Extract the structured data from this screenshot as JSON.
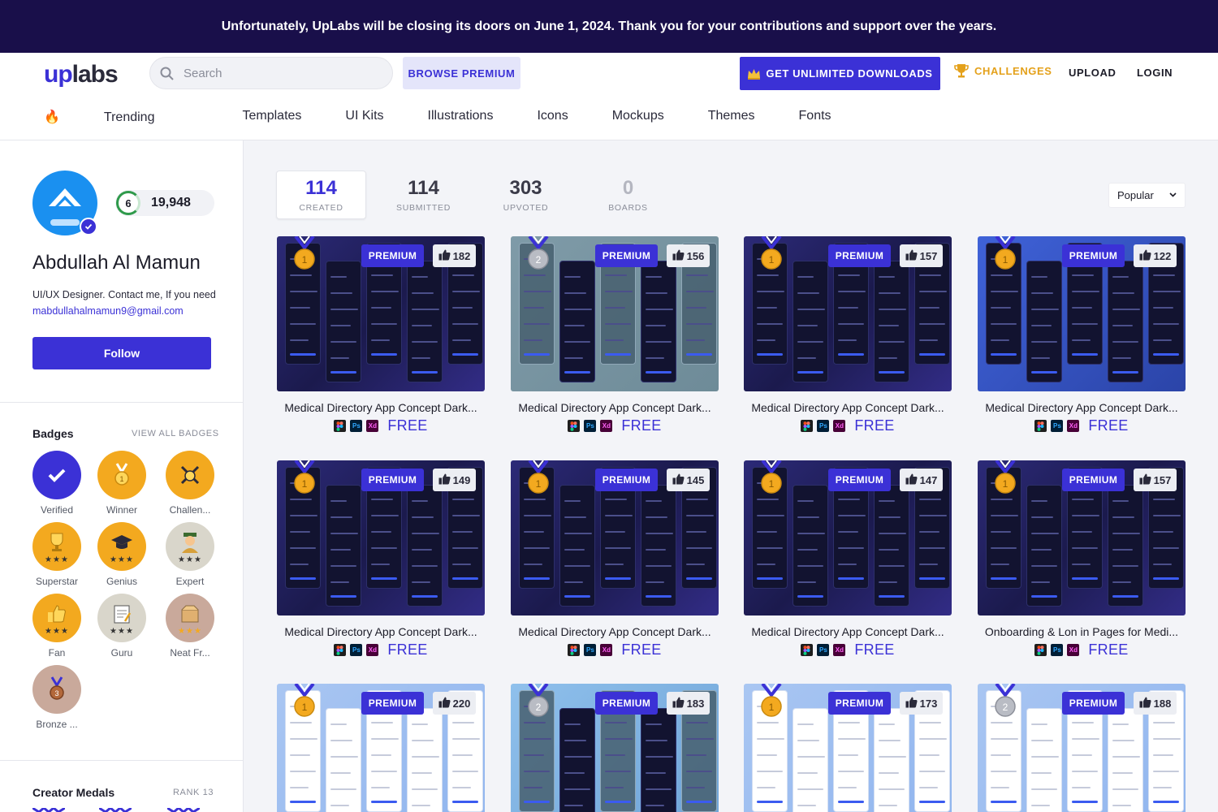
{
  "banner": {
    "text": "Unfortunately, UpLabs will be closing its doors on June 1, 2024. Thank you for your contributions and support over the years."
  },
  "header": {
    "logo_up": "up",
    "logo_labs": "labs",
    "search_placeholder": "Search",
    "browse_premium": "BROWSE PREMIUM",
    "get_unlimited": "GET UNLIMITED DOWNLOADS",
    "challenges": "CHALLENGES",
    "upload": "UPLOAD",
    "login": "LOGIN"
  },
  "nav": [
    {
      "label": "Trending",
      "icon": "fire-icon"
    },
    {
      "label": "Templates"
    },
    {
      "label": "UI Kits"
    },
    {
      "label": "Illustrations"
    },
    {
      "label": "Icons"
    },
    {
      "label": "Mockups"
    },
    {
      "label": "Themes"
    },
    {
      "label": "Fonts"
    }
  ],
  "profile": {
    "level": "6",
    "score": "19,948",
    "name": "Abdullah Al Mamun",
    "bio": "UI/UX Designer. Contact me, If you need",
    "email": "mabdullahalmamun9@gmail.com",
    "follow": "Follow"
  },
  "badges": {
    "title": "Badges",
    "view_all": "VIEW ALL BADGES",
    "items": [
      {
        "label": "Verified",
        "color": "#3b31d6",
        "icon": "check-icon"
      },
      {
        "label": "Winner",
        "color": "#f3a91f",
        "icon": "medal-icon"
      },
      {
        "label": "Challen...",
        "color": "#f3a91f",
        "icon": "swords-icon"
      },
      {
        "label": "Superstar",
        "color": "#f3a91f",
        "icon": "trophy-icon",
        "stars": "★★★"
      },
      {
        "label": "Genius",
        "color": "#f3a91f",
        "icon": "graduation-cap-icon",
        "stars": "★★★"
      },
      {
        "label": "Expert",
        "color": "#d9d6cb",
        "icon": "person-icon",
        "stars": "★★★"
      },
      {
        "label": "Fan",
        "color": "#f3a91f",
        "icon": "thumbs-up-icon",
        "stars": "★★★"
      },
      {
        "label": "Guru",
        "color": "#d9d6cb",
        "icon": "notepad-icon",
        "stars": "★★★"
      },
      {
        "label": "Neat Fr...",
        "color": "#c9a99b",
        "icon": "box-icon",
        "stars": "★★★"
      },
      {
        "label": "Bronze ...",
        "color": "#c9a99b",
        "icon": "bronze-medal-icon"
      }
    ]
  },
  "medals": {
    "title": "Creator Medals",
    "rank": "RANK 13"
  },
  "stats": [
    {
      "num": "114",
      "label": "CREATED"
    },
    {
      "num": "114",
      "label": "SUBMITTED"
    },
    {
      "num": "303",
      "label": "UPVOTED"
    },
    {
      "num": "0",
      "label": "BOARDS"
    }
  ],
  "sort": {
    "selected": "Popular"
  },
  "cards": [
    {
      "title": "Medical Directory App Concept Dark...",
      "likes": "182",
      "badge": "PREMIUM",
      "price": "FREE",
      "medal": "1"
    },
    {
      "title": "Medical Directory App Concept Dark...",
      "likes": "156",
      "badge": "PREMIUM",
      "price": "FREE",
      "medal": "2"
    },
    {
      "title": "Medical Directory App Concept Dark...",
      "likes": "157",
      "badge": "PREMIUM",
      "price": "FREE",
      "medal": "1"
    },
    {
      "title": "Medical Directory App Concept Dark...",
      "likes": "122",
      "badge": "PREMIUM",
      "price": "FREE",
      "medal": "1"
    },
    {
      "title": "Medical Directory App Concept Dark...",
      "likes": "149",
      "badge": "PREMIUM",
      "price": "FREE",
      "medal": "1"
    },
    {
      "title": "Medical Directory App Concept Dark...",
      "likes": "145",
      "badge": "PREMIUM",
      "price": "FREE",
      "medal": "1"
    },
    {
      "title": "Medical Directory App Concept Dark...",
      "likes": "147",
      "badge": "PREMIUM",
      "price": "FREE",
      "medal": "1"
    },
    {
      "title": "Onboarding & Lon in Pages for Medi...",
      "likes": "157",
      "badge": "PREMIUM",
      "price": "FREE",
      "medal": "1"
    },
    {
      "title": "",
      "likes": "220",
      "badge": "PREMIUM",
      "price": "",
      "medal": "1"
    },
    {
      "title": "",
      "likes": "183",
      "badge": "PREMIUM",
      "price": "",
      "medal": "2"
    },
    {
      "title": "",
      "likes": "173",
      "badge": "PREMIUM",
      "price": "",
      "medal": "1"
    },
    {
      "title": "",
      "likes": "188",
      "badge": "PREMIUM",
      "price": "",
      "medal": "2"
    }
  ],
  "colors": {
    "brand": "#3b31d6",
    "banner": "#190f4a",
    "challenges": "#e4a11b",
    "gold": "#f3a91f"
  }
}
